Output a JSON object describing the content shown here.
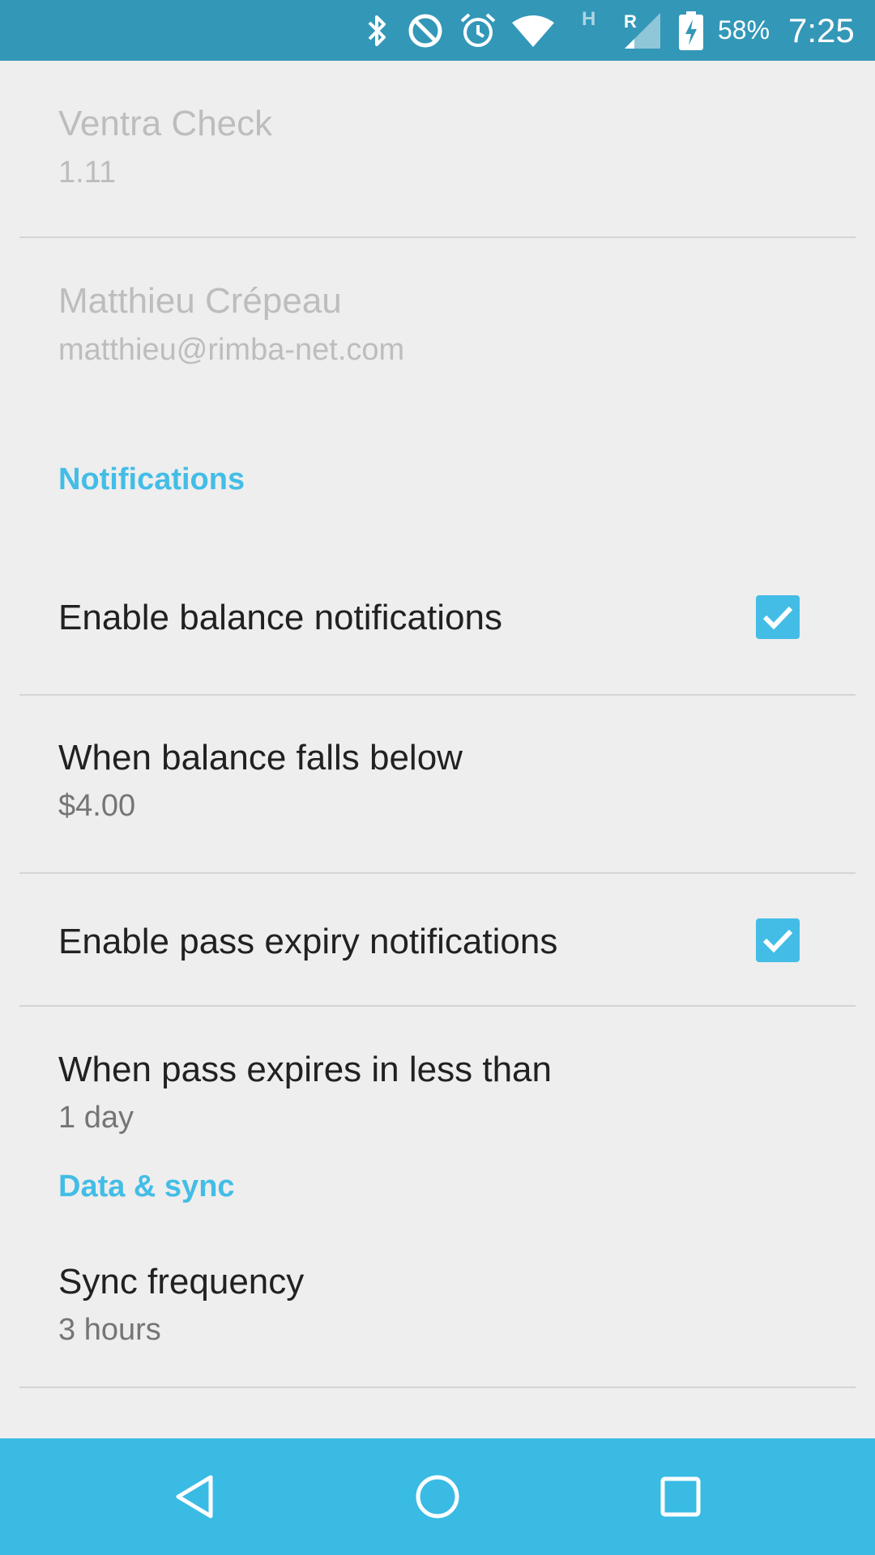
{
  "status_bar": {
    "battery_percent": "58%",
    "time": "7:25",
    "network_type": "H",
    "roaming": "R",
    "icons": [
      "bluetooth-icon",
      "do-not-disturb-icon",
      "alarm-icon",
      "wifi-icon",
      "signal-icon",
      "battery-charging-icon"
    ]
  },
  "app_info": {
    "name": "Ventra Check",
    "version": "1.11"
  },
  "account": {
    "name": "Matthieu Crépeau",
    "email": "matthieu@rimba-net.com"
  },
  "notifications": {
    "header": "Notifications",
    "balance_toggle": {
      "label": "Enable balance notifications",
      "checked": true
    },
    "balance_threshold": {
      "label": "When balance falls below",
      "value": "$4.00"
    },
    "pass_toggle": {
      "label": "Enable pass expiry notifications",
      "checked": true
    },
    "pass_threshold": {
      "label": "When pass expires in less than",
      "value": "1 day"
    }
  },
  "data_sync": {
    "header": "Data & sync",
    "sync_frequency": {
      "label": "Sync frequency",
      "value": "3 hours"
    }
  },
  "nav_bar": {
    "buttons": [
      "back-icon",
      "home-icon",
      "recents-icon"
    ]
  },
  "colors": {
    "status_bar": "#3397b8",
    "accent": "#43bde6",
    "nav_bar": "#39bbe4",
    "background": "#eeeeee"
  }
}
